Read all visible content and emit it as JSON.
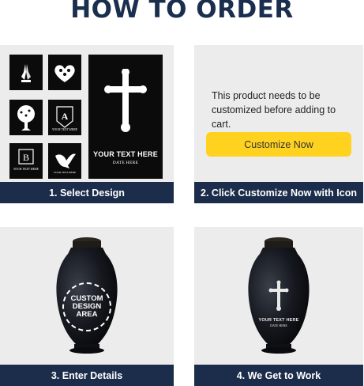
{
  "header": {
    "title": "HOW TO ORDER"
  },
  "steps": {
    "step1": {
      "label": "1. Select Design",
      "sample": {
        "your_text": "YOUR TEXT HERE",
        "date": "DATE HERE"
      },
      "tiles": [
        {
          "icon": "praying-hands-icon"
        },
        {
          "icon": "heart-of-hearts-icon"
        },
        {
          "icon": "tree-of-life-icon"
        },
        {
          "icon": "monogram-a-icon",
          "letter": "A"
        },
        {
          "icon": "monogram-b-icon",
          "letter": "B"
        },
        {
          "icon": "dove-icon"
        },
        {
          "icon": "cross-icon"
        }
      ]
    },
    "step2": {
      "label": "2. Click Customize Now with Icon",
      "message": "This product needs to be customized before adding to cart.",
      "button": "Customize Now"
    },
    "step3": {
      "label": "3. Enter Details",
      "circle_line1": "CUSTOM",
      "circle_line2": "DESIGN",
      "circle_line3": "AREA"
    },
    "step4": {
      "label": "4. We Get to Work",
      "urn_text": "YOUR TEXT HERE",
      "urn_date": "DATE HERE"
    }
  },
  "colors": {
    "title": "#1a2e4d",
    "label_bar": "#1c2d4b",
    "button": "#ffd21f",
    "card_bg": "#ececec",
    "tile_bg": "#0b0b0b"
  }
}
